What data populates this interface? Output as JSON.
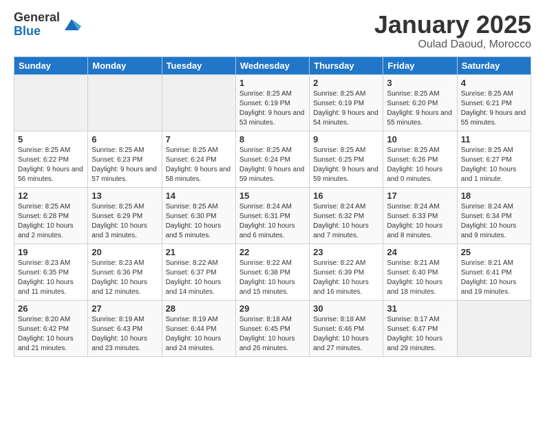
{
  "header": {
    "logo_general": "General",
    "logo_blue": "Blue",
    "title": "January 2025",
    "subtitle": "Oulad Daoud, Morocco"
  },
  "days_of_week": [
    "Sunday",
    "Monday",
    "Tuesday",
    "Wednesday",
    "Thursday",
    "Friday",
    "Saturday"
  ],
  "weeks": [
    [
      {
        "day": "",
        "info": ""
      },
      {
        "day": "",
        "info": ""
      },
      {
        "day": "",
        "info": ""
      },
      {
        "day": "1",
        "info": "Sunrise: 8:25 AM\nSunset: 6:19 PM\nDaylight: 9 hours and 53 minutes."
      },
      {
        "day": "2",
        "info": "Sunrise: 8:25 AM\nSunset: 6:19 PM\nDaylight: 9 hours and 54 minutes."
      },
      {
        "day": "3",
        "info": "Sunrise: 8:25 AM\nSunset: 6:20 PM\nDaylight: 9 hours and 55 minutes."
      },
      {
        "day": "4",
        "info": "Sunrise: 8:25 AM\nSunset: 6:21 PM\nDaylight: 9 hours and 55 minutes."
      }
    ],
    [
      {
        "day": "5",
        "info": "Sunrise: 8:25 AM\nSunset: 6:22 PM\nDaylight: 9 hours and 56 minutes."
      },
      {
        "day": "6",
        "info": "Sunrise: 8:25 AM\nSunset: 6:23 PM\nDaylight: 9 hours and 57 minutes."
      },
      {
        "day": "7",
        "info": "Sunrise: 8:25 AM\nSunset: 6:24 PM\nDaylight: 9 hours and 58 minutes."
      },
      {
        "day": "8",
        "info": "Sunrise: 8:25 AM\nSunset: 6:24 PM\nDaylight: 9 hours and 59 minutes."
      },
      {
        "day": "9",
        "info": "Sunrise: 8:25 AM\nSunset: 6:25 PM\nDaylight: 9 hours and 59 minutes."
      },
      {
        "day": "10",
        "info": "Sunrise: 8:25 AM\nSunset: 6:26 PM\nDaylight: 10 hours and 0 minutes."
      },
      {
        "day": "11",
        "info": "Sunrise: 8:25 AM\nSunset: 6:27 PM\nDaylight: 10 hours and 1 minute."
      }
    ],
    [
      {
        "day": "12",
        "info": "Sunrise: 8:25 AM\nSunset: 6:28 PM\nDaylight: 10 hours and 2 minutes."
      },
      {
        "day": "13",
        "info": "Sunrise: 8:25 AM\nSunset: 6:29 PM\nDaylight: 10 hours and 3 minutes."
      },
      {
        "day": "14",
        "info": "Sunrise: 8:25 AM\nSunset: 6:30 PM\nDaylight: 10 hours and 5 minutes."
      },
      {
        "day": "15",
        "info": "Sunrise: 8:24 AM\nSunset: 6:31 PM\nDaylight: 10 hours and 6 minutes."
      },
      {
        "day": "16",
        "info": "Sunrise: 8:24 AM\nSunset: 6:32 PM\nDaylight: 10 hours and 7 minutes."
      },
      {
        "day": "17",
        "info": "Sunrise: 8:24 AM\nSunset: 6:33 PM\nDaylight: 10 hours and 8 minutes."
      },
      {
        "day": "18",
        "info": "Sunrise: 8:24 AM\nSunset: 6:34 PM\nDaylight: 10 hours and 9 minutes."
      }
    ],
    [
      {
        "day": "19",
        "info": "Sunrise: 8:23 AM\nSunset: 6:35 PM\nDaylight: 10 hours and 11 minutes."
      },
      {
        "day": "20",
        "info": "Sunrise: 8:23 AM\nSunset: 6:36 PM\nDaylight: 10 hours and 12 minutes."
      },
      {
        "day": "21",
        "info": "Sunrise: 8:22 AM\nSunset: 6:37 PM\nDaylight: 10 hours and 14 minutes."
      },
      {
        "day": "22",
        "info": "Sunrise: 8:22 AM\nSunset: 6:38 PM\nDaylight: 10 hours and 15 minutes."
      },
      {
        "day": "23",
        "info": "Sunrise: 8:22 AM\nSunset: 6:39 PM\nDaylight: 10 hours and 16 minutes."
      },
      {
        "day": "24",
        "info": "Sunrise: 8:21 AM\nSunset: 6:40 PM\nDaylight: 10 hours and 18 minutes."
      },
      {
        "day": "25",
        "info": "Sunrise: 8:21 AM\nSunset: 6:41 PM\nDaylight: 10 hours and 19 minutes."
      }
    ],
    [
      {
        "day": "26",
        "info": "Sunrise: 8:20 AM\nSunset: 6:42 PM\nDaylight: 10 hours and 21 minutes."
      },
      {
        "day": "27",
        "info": "Sunrise: 8:19 AM\nSunset: 6:43 PM\nDaylight: 10 hours and 23 minutes."
      },
      {
        "day": "28",
        "info": "Sunrise: 8:19 AM\nSunset: 6:44 PM\nDaylight: 10 hours and 24 minutes."
      },
      {
        "day": "29",
        "info": "Sunrise: 8:18 AM\nSunset: 6:45 PM\nDaylight: 10 hours and 26 minutes."
      },
      {
        "day": "30",
        "info": "Sunrise: 8:18 AM\nSunset: 6:46 PM\nDaylight: 10 hours and 27 minutes."
      },
      {
        "day": "31",
        "info": "Sunrise: 8:17 AM\nSunset: 6:47 PM\nDaylight: 10 hours and 29 minutes."
      },
      {
        "day": "",
        "info": ""
      }
    ]
  ]
}
